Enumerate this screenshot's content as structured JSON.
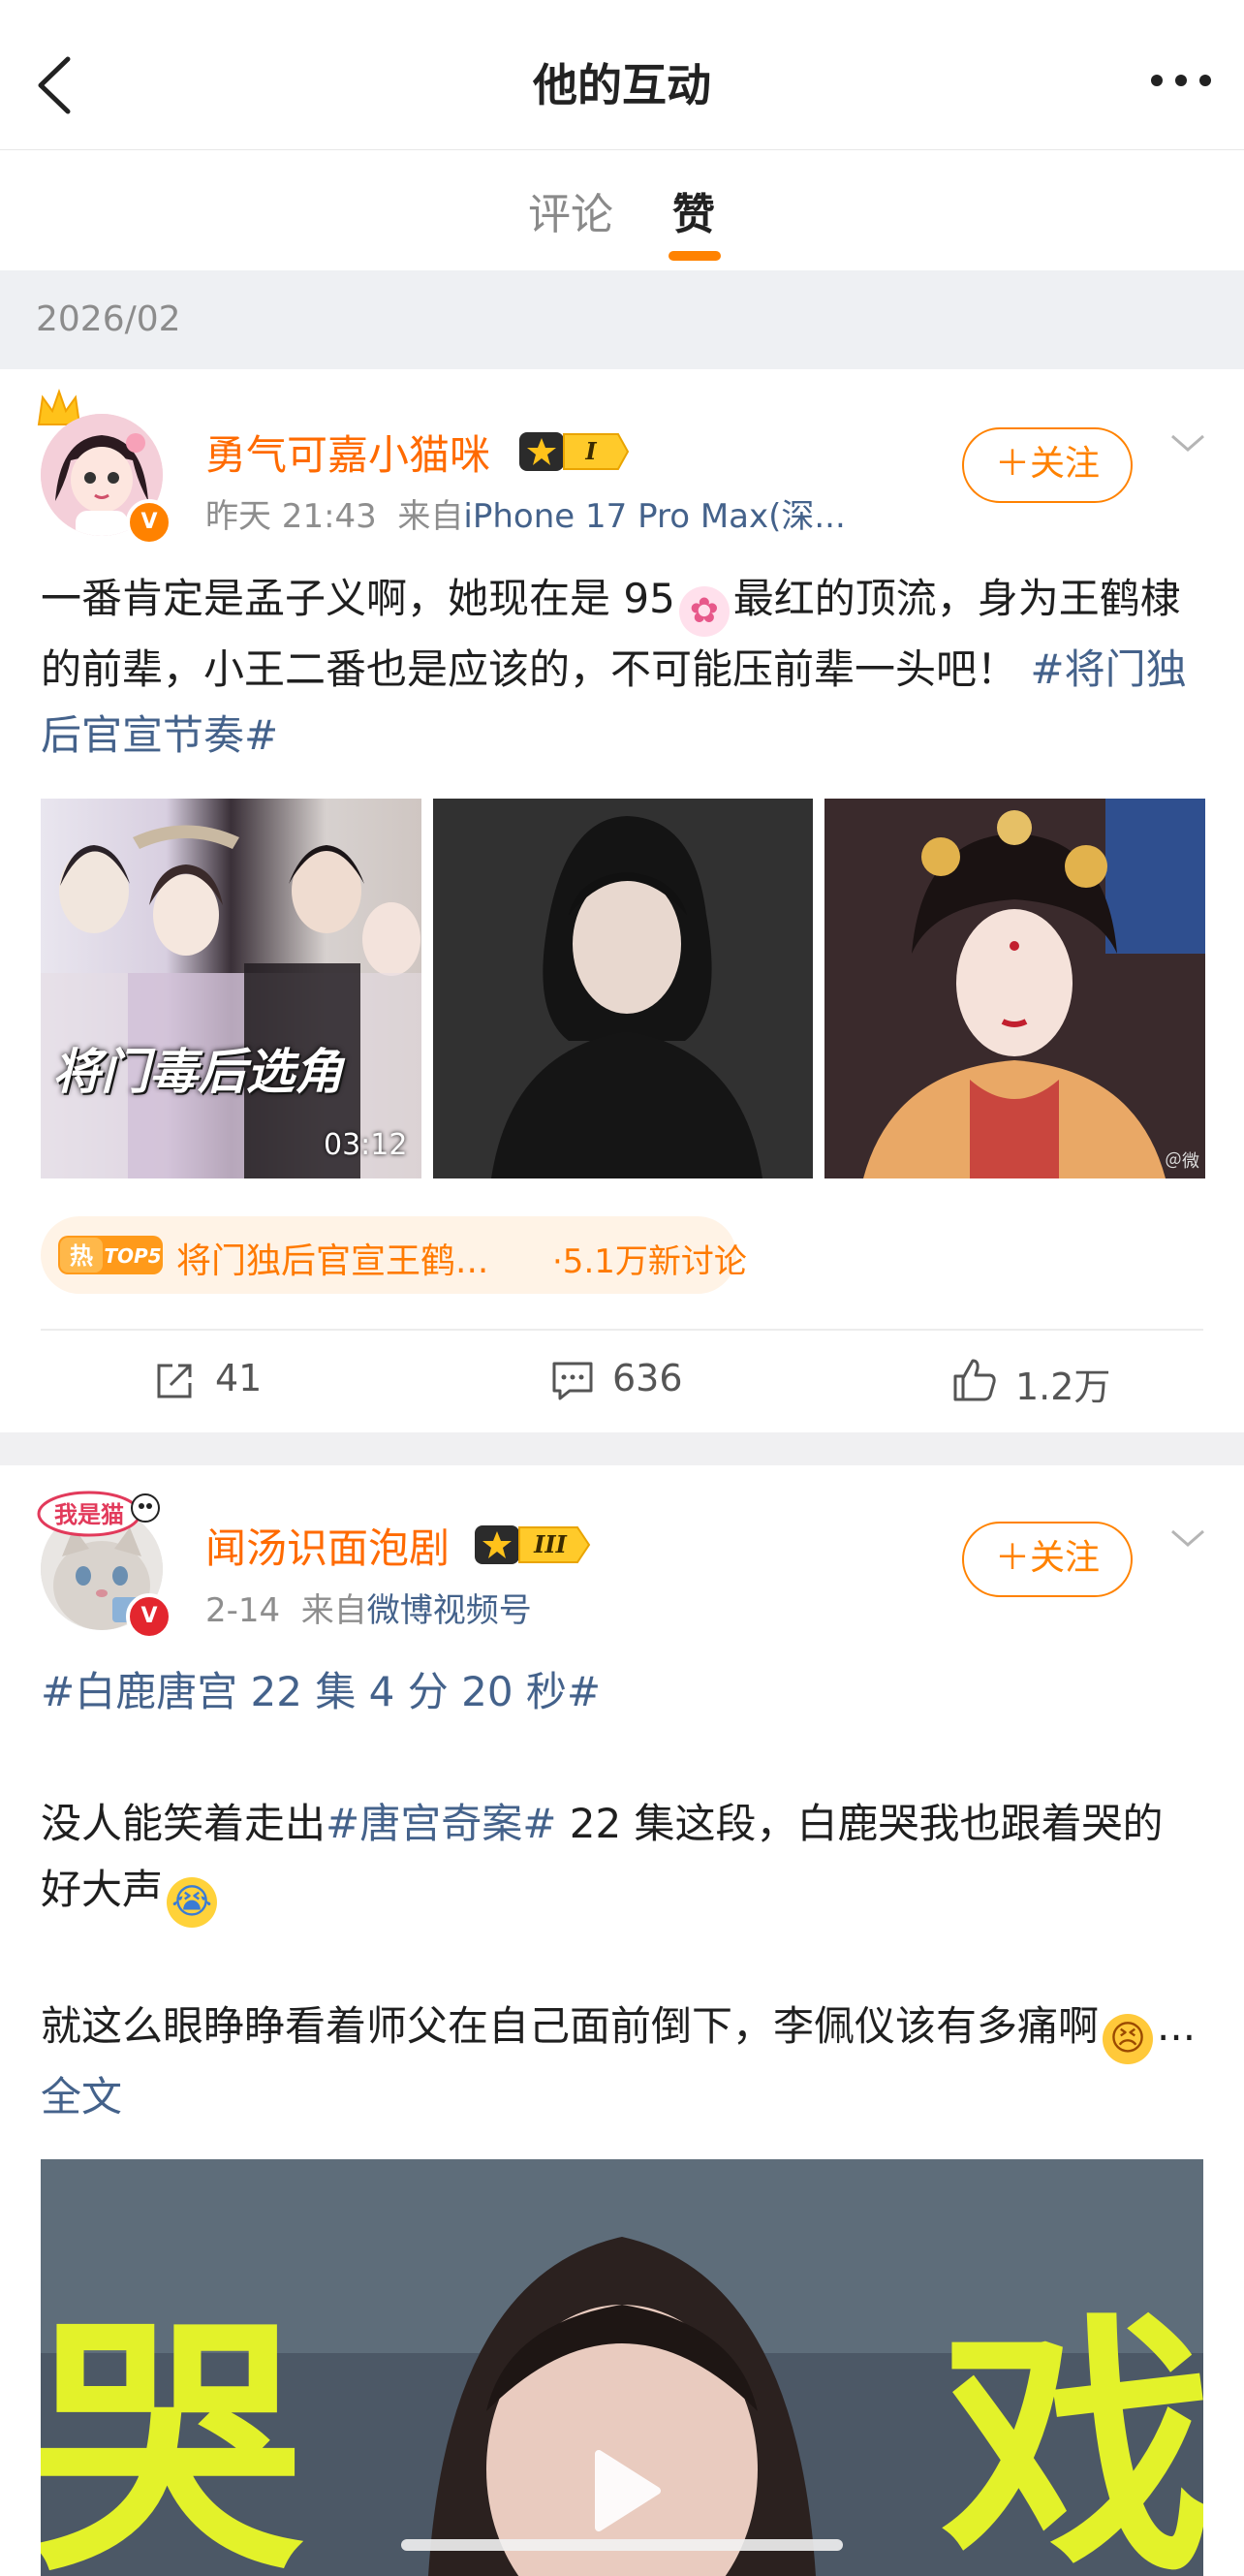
{
  "header": {
    "title": "他的互动"
  },
  "tabs": [
    {
      "label": "评论",
      "active": false
    },
    {
      "label": "赞",
      "active": true
    }
  ],
  "date_group": "2026/02",
  "posts": [
    {
      "username": "勇气可嘉小猫咪",
      "level_badge": "I",
      "time": "昨天 21:43",
      "source_prefix": "来自",
      "source": "iPhone 17 Pro Max(深...",
      "follow_label": "＋关注",
      "text_1": "一番肯定是孟子义啊，她现在是 95",
      "text_2": "最红的顶流，身为王鹤棣的前辈，小王二番也是应该的，不可能压前辈一头吧！",
      "hashtag": "#将门独后官宣节奏#",
      "thumb_1_caption": "将门毒后选角",
      "thumb_1_duration": "03:12",
      "thumb_3_watermark": "＠微",
      "hot_badge": "TOP5",
      "hot_topic": "将门独后官宣王鹤...",
      "hot_count": "·5.1万新讨论",
      "reposts": "41",
      "comments": "636",
      "likes": "1.2万"
    },
    {
      "username": "闻汤识面泡剧",
      "level_badge": "III",
      "avatar_text": "我是猫",
      "time": "2-14",
      "source_prefix": "来自",
      "source": "微博视频号",
      "follow_label": "＋关注",
      "hashtag_line": "#白鹿唐宫 22 集 4 分 20 秒#",
      "para2_a": "没人能笑着走出",
      "para2_tag": "#唐宫奇案#",
      "para2_b": " 22 集这段，白鹿哭我也跟着哭的好大声",
      "para3": "就这么眼睁睁看着师父在自己面前倒下，李佩仪该有多痛啊",
      "ellipsis": "...",
      "full_text": "全文",
      "video_char_left": "哭",
      "video_char_right": "戏"
    }
  ],
  "colors": {
    "accent": "#ff8200",
    "link": "#44628b",
    "username": "#ff6a00"
  },
  "icons": [
    "back-arrow-icon",
    "more-icon",
    "verified-icon",
    "chevron-down-icon",
    "repost-icon",
    "comment-icon",
    "like-icon",
    "play-icon",
    "hot-icon"
  ]
}
